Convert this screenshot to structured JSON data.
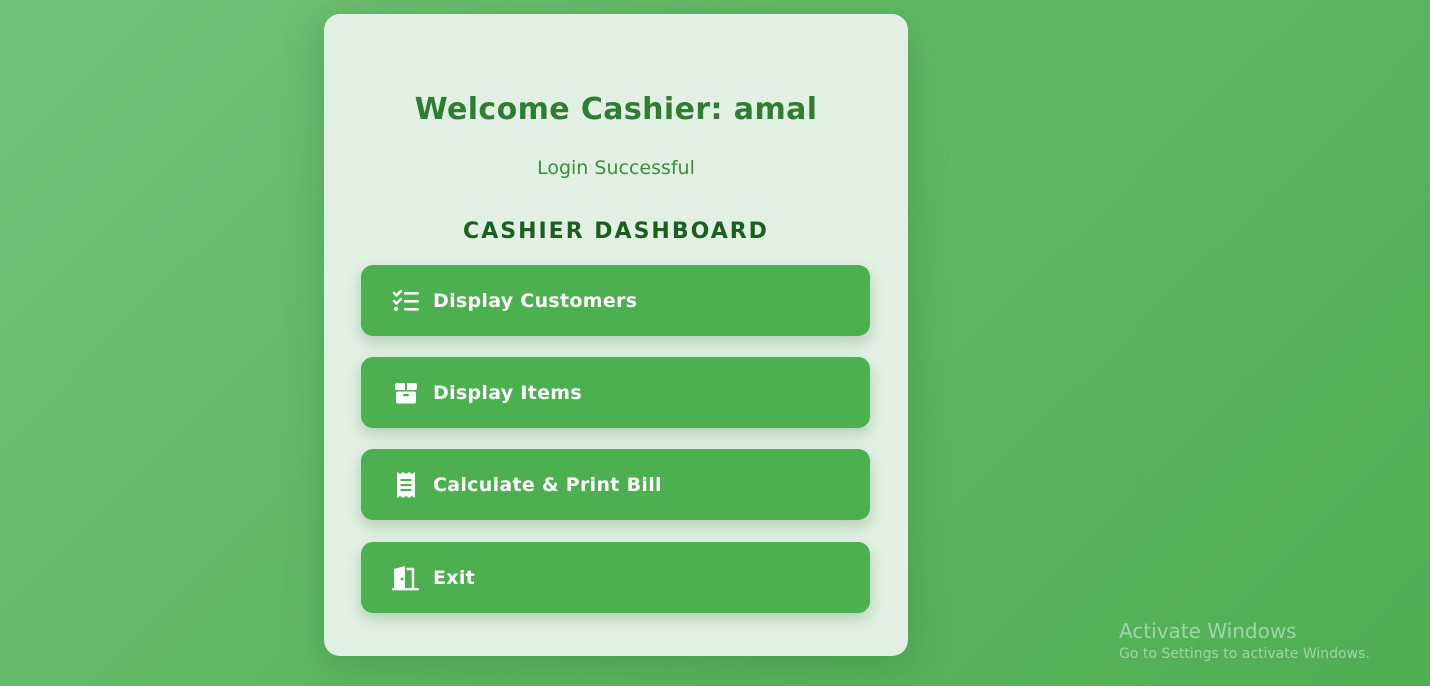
{
  "card": {
    "welcome_text": "Welcome Cashier: amal",
    "status_text": "Login Successful",
    "dashboard_title": "CASHIER DASHBOARD"
  },
  "menu": {
    "items": [
      {
        "label": "Display Customers",
        "icon": "list-check-icon"
      },
      {
        "label": "Display Items",
        "icon": "box-icon"
      },
      {
        "label": "Calculate & Print Bill",
        "icon": "receipt-icon"
      },
      {
        "label": "Exit",
        "icon": "door-exit-icon"
      }
    ]
  },
  "watermark": {
    "title": "Activate Windows",
    "subtitle": "Go to Settings to activate Windows."
  },
  "colors": {
    "background": "#5db862",
    "card": "#e2f0e3",
    "button": "#4caf50",
    "heading": "#2e7d32",
    "title": "#1b5e20"
  }
}
